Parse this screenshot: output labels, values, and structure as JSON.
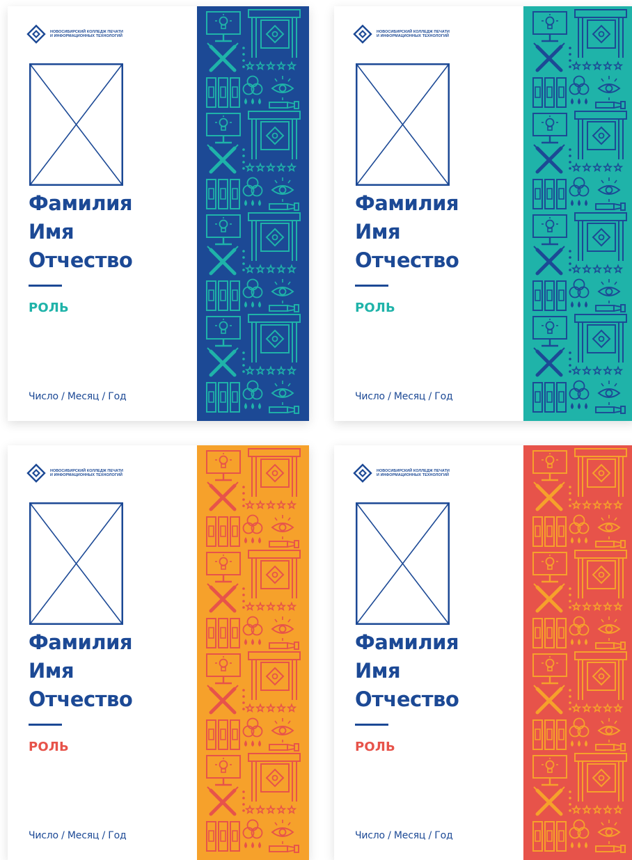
{
  "college": {
    "line1": "НОВОСИБИРСКИЙ КОЛЛЕДЖ ПЕЧАТИ",
    "line2": "И ИНФОРМАЦИОННЫХ ТЕХНОЛОГИЙ"
  },
  "badge": {
    "name_line1": "Фамилия",
    "name_line2": "Имя",
    "name_line3": "Отчество",
    "role": "РОЛЬ",
    "date": "Число / Месяц / Год"
  },
  "brand_color": "#1c4995",
  "variants": [
    {
      "strip_color": "#1c4995",
      "pattern_color": "#1fb3a9",
      "role_color": "#1fb3a9"
    },
    {
      "strip_color": "#1fb3a9",
      "pattern_color": "#1c4995",
      "role_color": "#1fb3a9"
    },
    {
      "strip_color": "#f6a12b",
      "pattern_color": "#e7534a",
      "role_color": "#e7534a"
    },
    {
      "strip_color": "#e7534a",
      "pattern_color": "#f6a12b",
      "role_color": "#e7534a"
    }
  ],
  "icons": [
    "college-logo-icon",
    "photo-placeholder-icon",
    "monitor-lightbulb-icon",
    "plotter-icon",
    "crossed-brushes-icon",
    "stars-icon",
    "binders-icon",
    "color-circles-icon",
    "eye-icon",
    "ink-drops-icon",
    "pen-icon"
  ]
}
